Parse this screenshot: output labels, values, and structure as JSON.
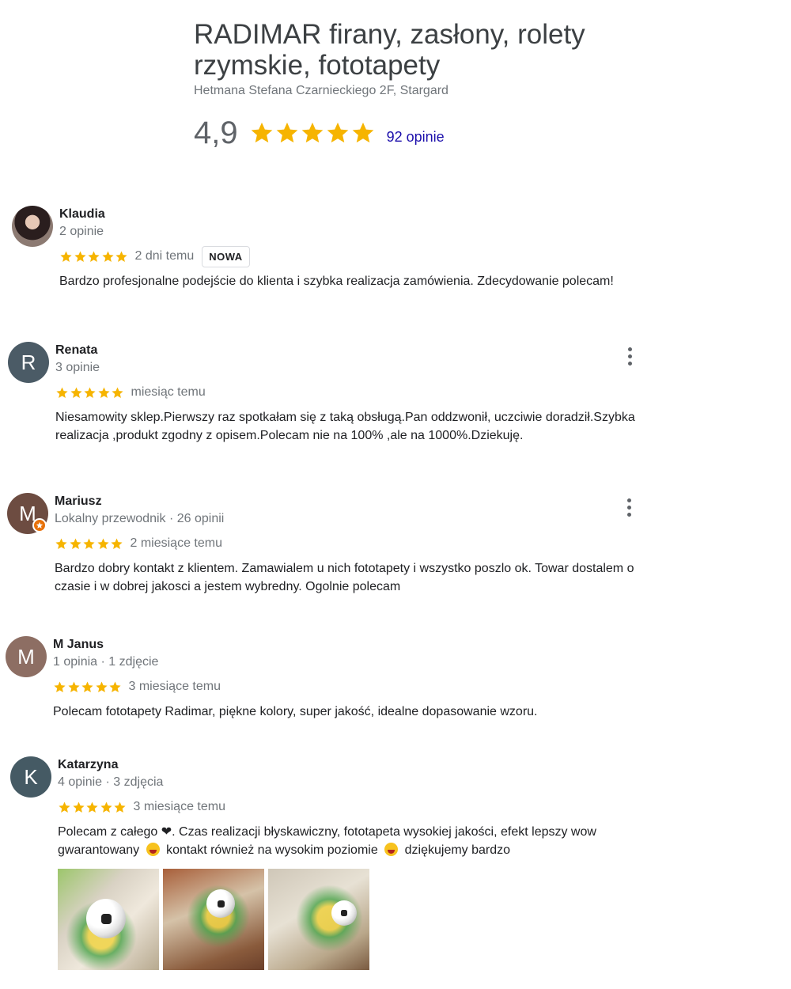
{
  "business": {
    "title": "RADIMAR firany, zasłony, rolety rzymskie, fototapety",
    "address": "Hetmana Stefana Czarnieckiego 2F, Stargard",
    "rating": "4,9",
    "rating_stars": 5,
    "reviews_count": "92 opinie"
  },
  "colors": {
    "star": "#f6b400",
    "link": "#1a0dab",
    "avatar_renata": "#4b5b66",
    "avatar_mariusz": "#6d4c41",
    "avatar_mjanus": "#8d6e63",
    "avatar_katarzyna": "#455a64",
    "guide_badge": "#e8710a"
  },
  "reviews": [
    {
      "name": "Klaudia",
      "meta": "2 opinie",
      "stars": 5,
      "date": "2 dni temu",
      "badge": "NOWA",
      "text": "Bardzo profesjonalne podejście do klienta i szybka realizacja zamówienia. Zdecydowanie polecam!"
    },
    {
      "name": "Renata",
      "initial": "R",
      "meta": "3 opinie",
      "stars": 5,
      "date": "miesiąc temu",
      "text": "Niesamowity sklep.Pierwszy raz spotkałam się z taką obsługą.Pan oddzwonił, uczciwie doradził.Szybka realizacja ,produkt zgodny z opisem.Polecam nie na 100% ,ale na 1000%.Dziekuję."
    },
    {
      "name": "Mariusz",
      "initial": "M",
      "meta": "Lokalny przewodnik · 26 opinii",
      "stars": 5,
      "date": "2 miesiące temu",
      "text": "Bardzo dobry kontakt z klientem. Zamawialem u nich fototapety i wszystko poszlo ok. Towar dostalem o czasie i w dobrej jakosci a jestem wybredny. Ogolnie polecam"
    },
    {
      "name": "M Janus",
      "initial": "M",
      "meta": "1 opinia · 1 zdjęcie",
      "stars": 5,
      "date": "3 miesiące temu",
      "text": "Polecam fototapety Radimar, piękne kolory, super jakość, idealne dopasowanie wzoru."
    },
    {
      "name": "Katarzyna",
      "initial": "K",
      "meta": "4 opinie · 3 zdjęcia",
      "stars": 5,
      "date": "3 miesiące temu",
      "text_part1": "Polecam z całego ",
      "text_heart": "❤",
      "text_part2": ". Czas realizacji błyskawiczny, fototapeta wysokiej jakości, efekt lepszy wow gwarantowany ",
      "text_part3": " kontakt również na wysokim poziomie ",
      "text_part4": " dziękujemy bardzo",
      "photos": [
        "football-wallpaper-photo",
        "football-wallpaper-photo",
        "football-wallpaper-photo"
      ]
    }
  ]
}
